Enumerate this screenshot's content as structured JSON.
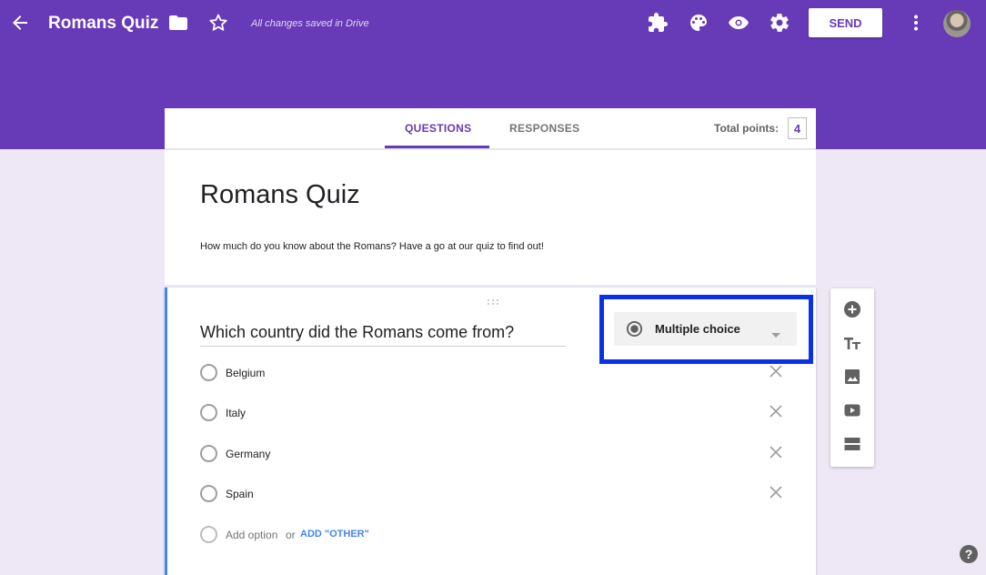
{
  "header": {
    "title": "Romans Quiz",
    "save_status": "All changes saved in Drive",
    "send_label": "SEND",
    "accent": "#673ab7"
  },
  "tabs": [
    {
      "label": "QUESTIONS",
      "active": true
    },
    {
      "label": "RESPONSES",
      "active": false
    }
  ],
  "points": {
    "label": "Total points:",
    "value": "4"
  },
  "form": {
    "title": "Romans Quiz",
    "description": "How much do you know about the Romans? Have a go at our quiz to find out!"
  },
  "question": {
    "title": "Which country did the Romans come from?",
    "type_label": "Multiple choice",
    "options": [
      "Belgium",
      "Italy",
      "Germany",
      "Spain"
    ],
    "add_option": "Add option",
    "or": "or",
    "add_other": "ADD \"OTHER\""
  },
  "icons": {
    "back": "arrow-left-icon",
    "folder": "folder-icon",
    "star": "star-outline-icon",
    "addons": "puzzle-icon",
    "palette": "palette-icon",
    "preview": "eye-icon",
    "settings": "gear-icon",
    "more": "more-vert-icon",
    "help": "help-icon"
  }
}
